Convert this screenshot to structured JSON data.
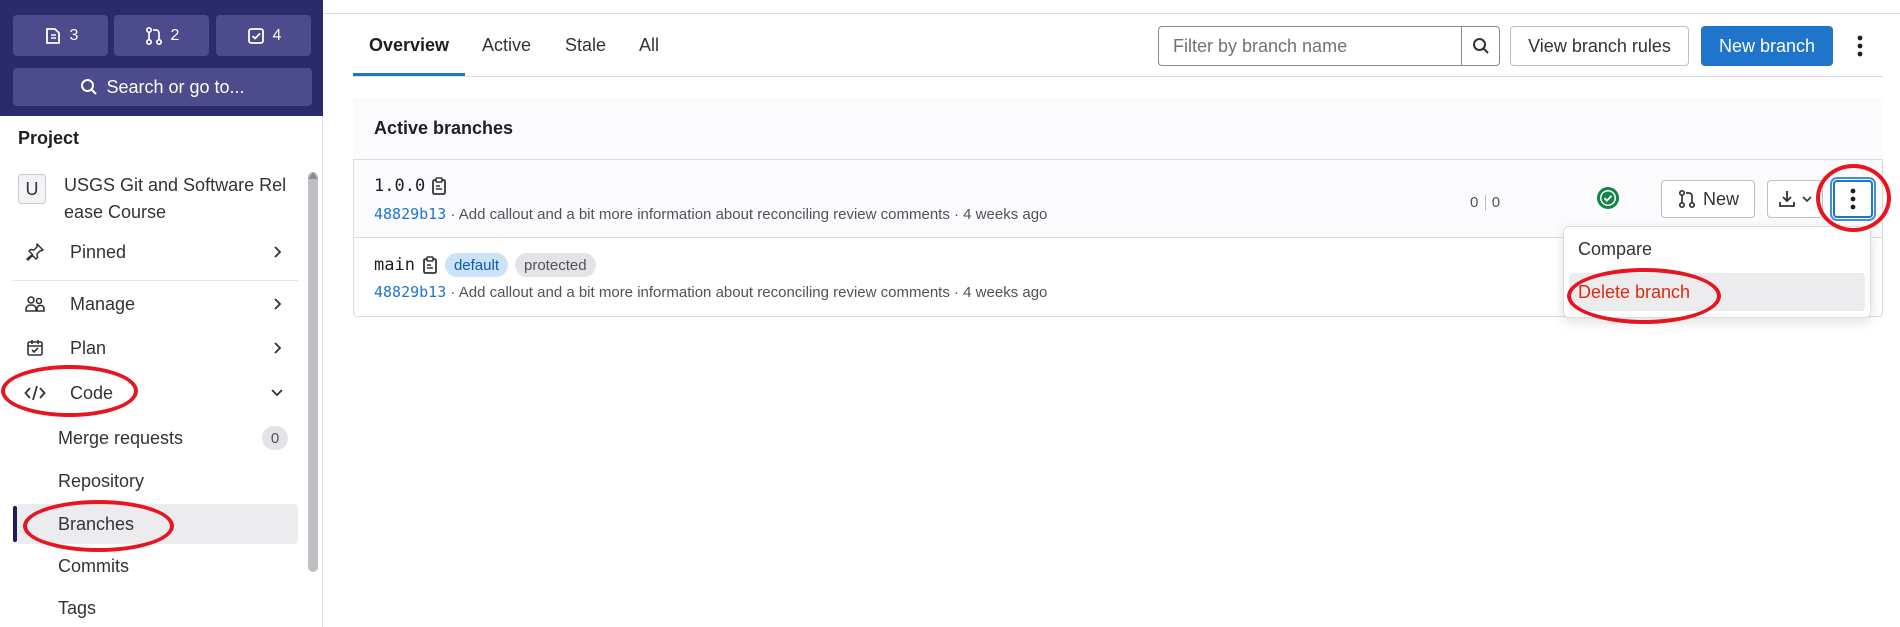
{
  "sidebar": {
    "counts": [
      {
        "icon": "issues-icon",
        "value": "3"
      },
      {
        "icon": "merge-request-icon",
        "value": "2"
      },
      {
        "icon": "todo-icon",
        "value": "4"
      }
    ],
    "search_label": "Search or go to...",
    "section_heading": "Project",
    "project_avatar_letter": "U",
    "project_name_line1": "USGS Git and Software Rel",
    "project_name_line2": "ease Course",
    "pinned": "Pinned",
    "manage": "Manage",
    "plan": "Plan",
    "code": "Code",
    "merge_requests": "Merge requests",
    "merge_requests_count": "0",
    "repository": "Repository",
    "branches": "Branches",
    "commits": "Commits",
    "tags": "Tags"
  },
  "tabs": [
    {
      "label": "Overview",
      "active": true
    },
    {
      "label": "Active"
    },
    {
      "label": "Stale"
    },
    {
      "label": "All"
    }
  ],
  "filter": {
    "placeholder": "Filter by branch name"
  },
  "buttons": {
    "view_rules": "View branch rules",
    "new_branch": "New branch",
    "row_new": "New"
  },
  "card": {
    "title": "Active branches"
  },
  "branches": [
    {
      "name": "1.0.0",
      "sha": "48829b13",
      "message": "· Add callout and a bit more information about reconciling review comments · 4 weeks ago",
      "behind": "0",
      "ahead": "0",
      "pipeline": "passed"
    },
    {
      "name": "main",
      "badges": [
        "default",
        "protected"
      ],
      "sha": "48829b13",
      "message": "· Add callout and a bit more information about reconciling review comments · 4 weeks ago"
    }
  ],
  "dropdown": {
    "compare": "Compare",
    "delete": "Delete branch"
  },
  "colors": {
    "sidebar_top": "#2b2a6b",
    "primary": "#1f75cb",
    "danger": "#dd2b0e",
    "success": "#108548",
    "annotation": "#e8141f"
  }
}
